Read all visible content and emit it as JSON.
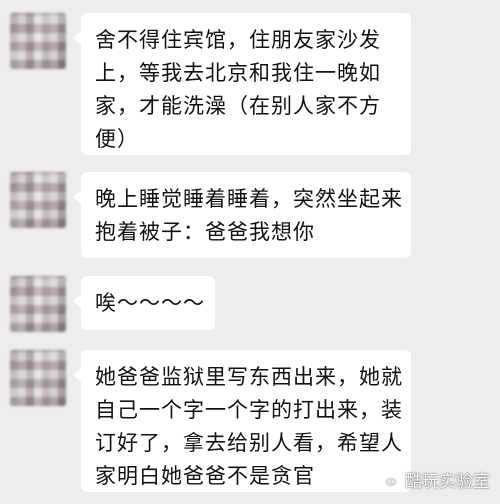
{
  "chat": {
    "messages": [
      {
        "lines": [
          "舍不得住宾馆，住朋友家沙发",
          "上，等我去北京和我住一晚如",
          "家，才能洗澡（在别人家不方",
          "便）"
        ]
      },
      {
        "lines": [
          "晚上睡觉睡着睡着，突然坐起来",
          "抱着被子：爸爸我想你"
        ]
      },
      {
        "lines": [
          "唉～～～～"
        ]
      },
      {
        "lines": [
          "她爸爸监狱里写东西出来，她就",
          "自己一个字一个字的打出来，装",
          "订好了，拿去给别人看，希望人",
          "家明白她爸爸不是贪官"
        ]
      }
    ]
  },
  "watermark": {
    "text": "酷玩实验室",
    "icon": "wechat-logo-icon"
  },
  "colors": {
    "background": "#ededed",
    "bubble": "#ffffff",
    "text": "#111111"
  }
}
